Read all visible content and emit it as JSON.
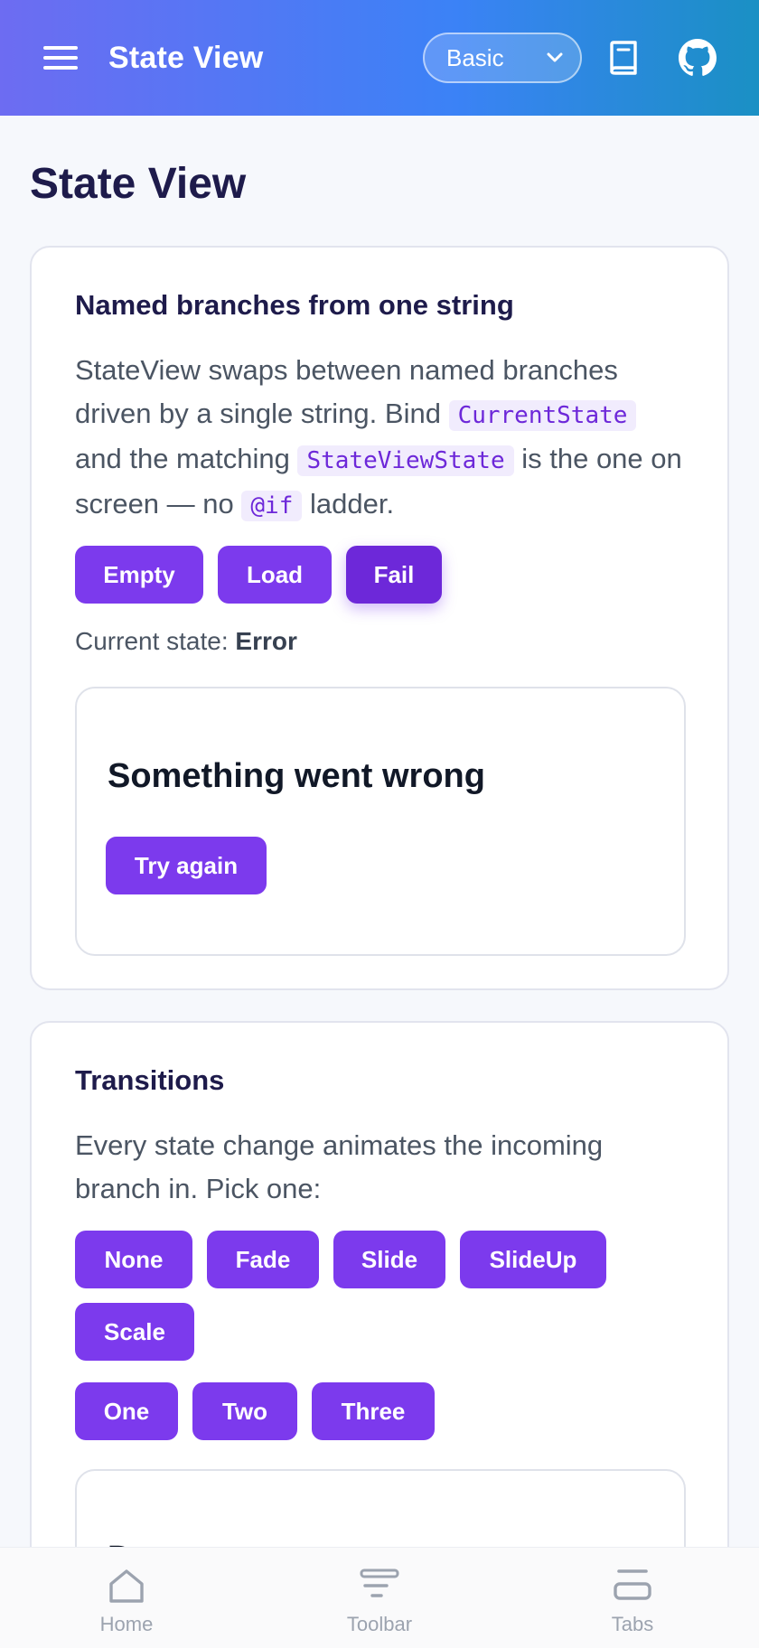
{
  "appbar": {
    "title": "State View",
    "variant_selected": "Basic",
    "menu_icon": "hamburger-icon",
    "docs_icon": "book-icon",
    "github_icon": "github-icon"
  },
  "page": {
    "title": "State View"
  },
  "named_branches": {
    "title": "Named branches from one string",
    "desc_1": "StateView swaps between named branches driven by a single string. Bind",
    "code_1": "CurrentState",
    "desc_2": "and the matching",
    "code_2": "StateViewState",
    "desc_3": "is the one on screen — no",
    "code_3": "@if",
    "desc_4": "ladder.",
    "buttons": [
      "Empty",
      "Load",
      "Fail"
    ],
    "current_state_label": "Current state:",
    "current_state_value": "Error",
    "error_title": "Something went wrong",
    "retry_label": "Try again"
  },
  "transitions": {
    "title": "Transitions",
    "desc": "Every state change animates the incoming branch in. Pick one:",
    "modes": [
      "None",
      "Fade",
      "Slide",
      "SlideUp",
      "Scale"
    ],
    "targets": [
      "One",
      "Two",
      "Three"
    ],
    "preview_title": "Done"
  },
  "bottomnav": {
    "items": [
      "Home",
      "Toolbar",
      "Tabs"
    ]
  },
  "colors": {
    "accent": "#7c3aed",
    "header_start": "#6d6cf2",
    "header_end": "#1a90c4"
  }
}
